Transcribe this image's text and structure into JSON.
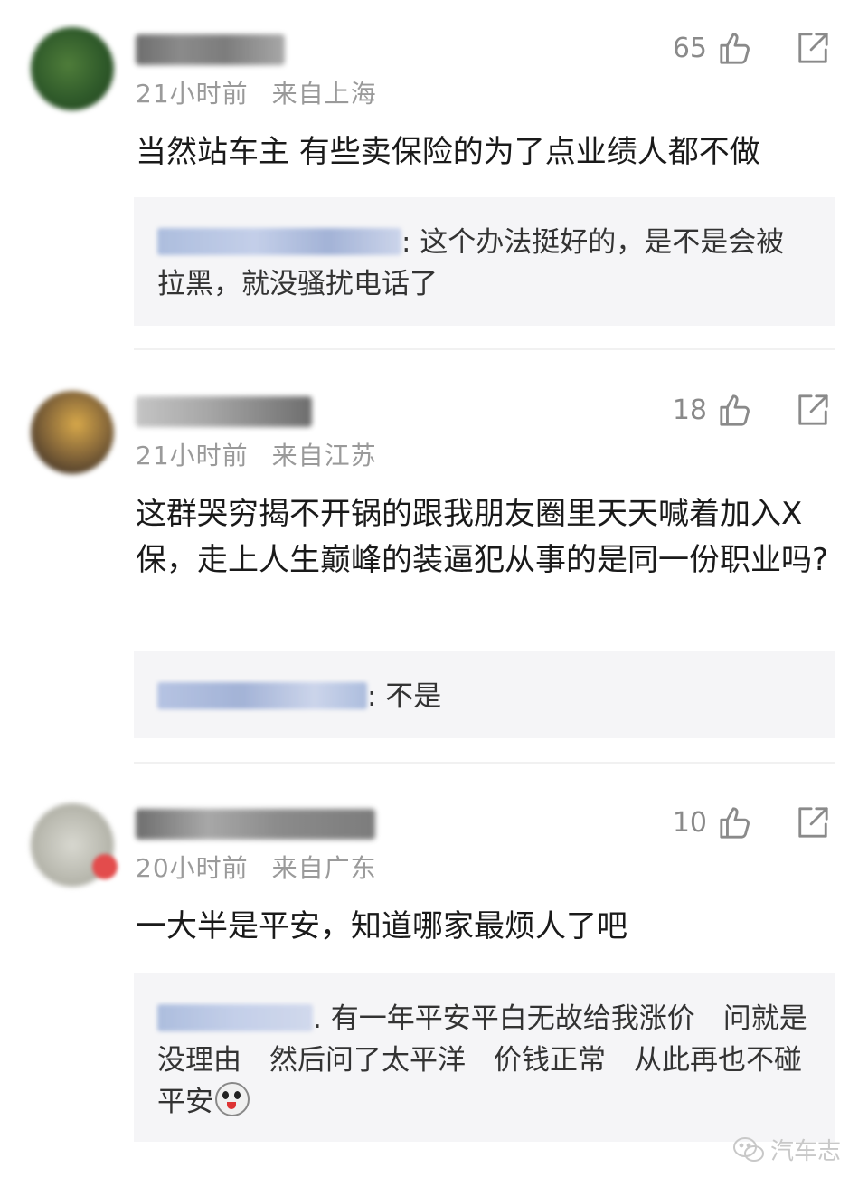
{
  "comments": [
    {
      "time": "21小时前",
      "location": "来自上海",
      "likes": "65",
      "text": "当然站车主 有些卖保险的为了点业绩人都不做",
      "reply": {
        "text": ": 这个办法挺好的，是不是会被拉黑，就没骚扰电话了"
      }
    },
    {
      "time": "21小时前",
      "location": "来自江苏",
      "likes": "18",
      "text": "这群哭穷揭不开锅的跟我朋友圈里天天喊着加入X保，走上人生巅峰的装逼犯从事的是同一份职业吗?",
      "reply": {
        "text": ": 不是"
      }
    },
    {
      "time": "20小时前",
      "location": "来自广东",
      "likes": "10",
      "text": "一大半是平安，知道哪家最烦人了吧",
      "reply": {
        "text": ". 有一年平安平白无故给我涨价　问就是没理由　然后问了太平洋　价钱正常　从此再也不碰平安"
      }
    }
  ],
  "watermark": {
    "text": "汽车志",
    "icon": "wechat-icon"
  },
  "colors": {
    "meta": "#9a9a9a",
    "reply_bg": "#f5f5f7",
    "text": "#1a1a1a"
  }
}
